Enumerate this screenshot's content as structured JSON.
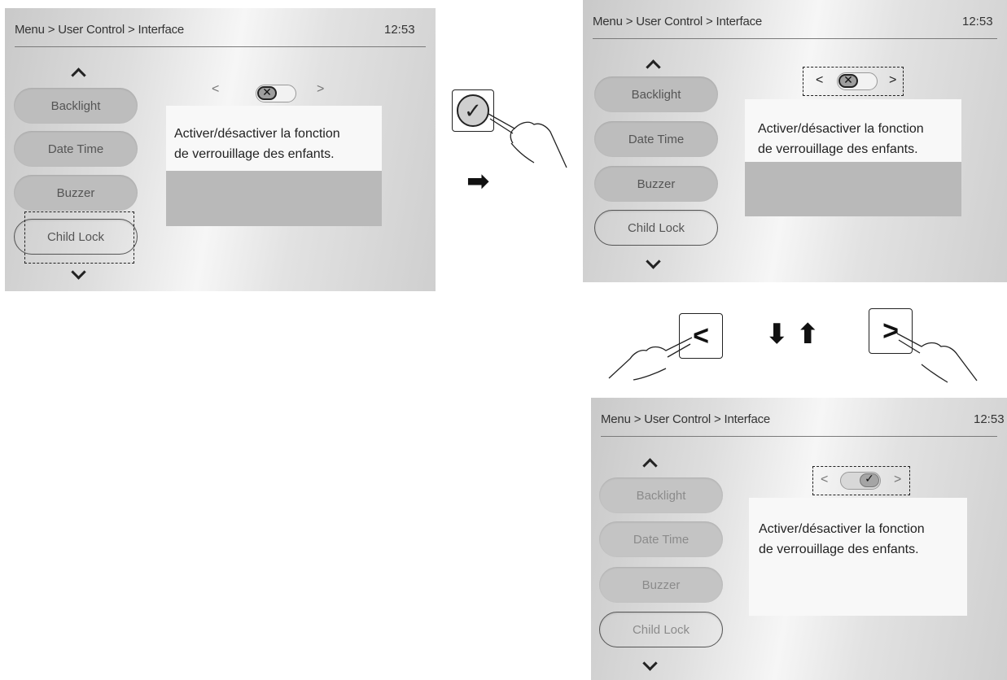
{
  "breadcrumb": "Menu > User Control > Interface",
  "clock": "12:53",
  "menu_items": [
    "Backlight",
    "Date Time",
    "Buzzer",
    "Child Lock"
  ],
  "description": {
    "line1": "Activer/désactiver la fonction",
    "line2": "de verrouillage des enfants."
  },
  "nav": {
    "prev": "<",
    "next": ">"
  },
  "toggle_states": {
    "off_symbol": "✕",
    "on_symbol": "✓"
  },
  "action_buttons": {
    "confirm_symbol": "✓",
    "left_symbol": "<",
    "right_symbol": ">"
  },
  "flow_arrows": {
    "next_step": "➡",
    "down": "⬇",
    "up": "⬆"
  },
  "icons": [
    "chevron-up-icon",
    "chevron-down-icon",
    "check-icon",
    "close-icon",
    "hand-pointer-icon",
    "arrow-right-icon",
    "arrow-down-icon",
    "arrow-up-icon"
  ]
}
